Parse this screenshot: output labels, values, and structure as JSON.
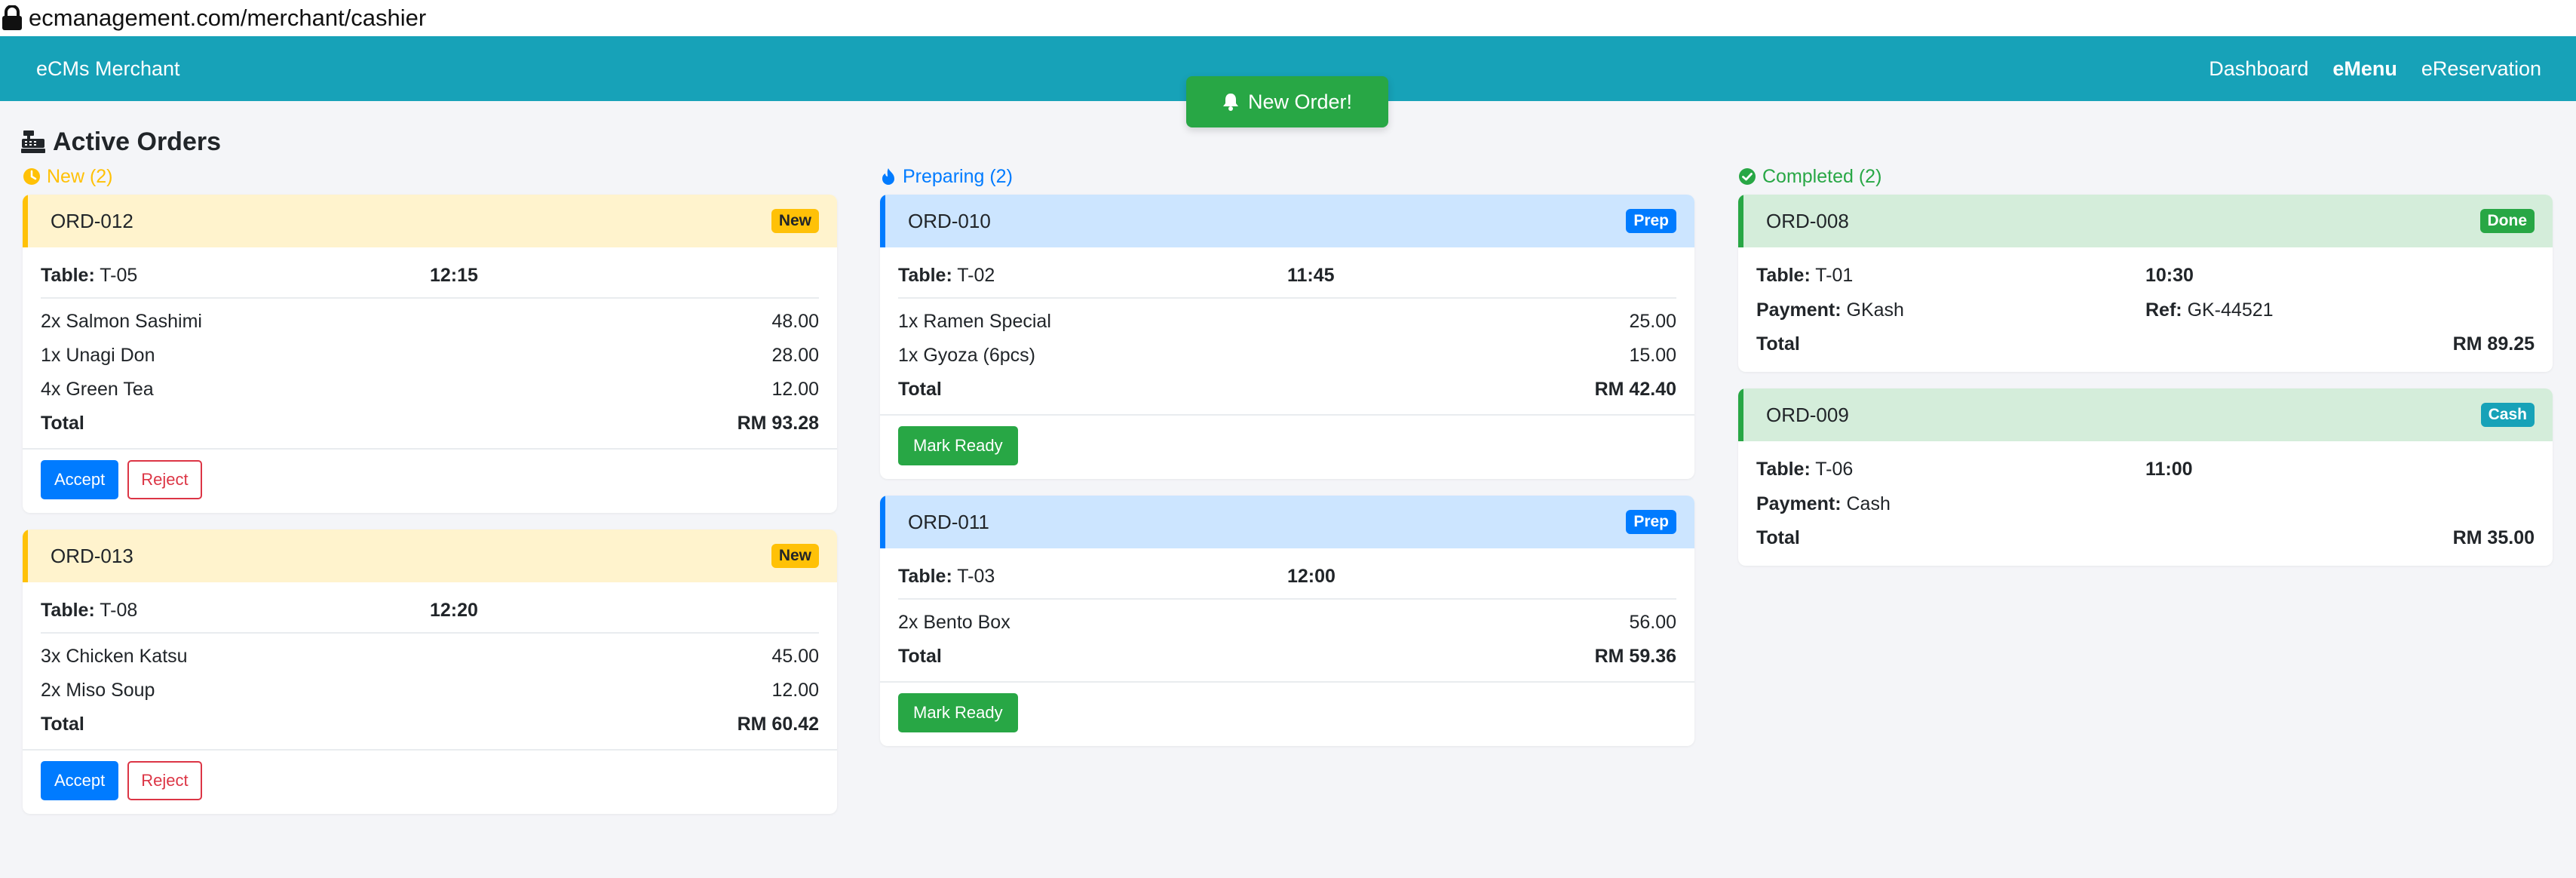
{
  "browser": {
    "url": "ecmanagement.com/merchant/cashier"
  },
  "navbar": {
    "brand": "eCMs Merchant",
    "links": [
      {
        "label": "Dashboard",
        "active": false
      },
      {
        "label": "eMenu",
        "active": true
      },
      {
        "label": "eReservation",
        "active": false
      }
    ]
  },
  "new_order_button": {
    "label": "New Order!"
  },
  "page": {
    "title": "Active Orders"
  },
  "columns": {
    "new": {
      "heading": "New (2)",
      "color": "#ffc107",
      "orders": [
        {
          "id": "ORD-012",
          "badge": "New",
          "table_label": "Table:",
          "table": "T-05",
          "time": "12:15",
          "items": [
            {
              "name": "2x Salmon Sashimi",
              "price": "48.00"
            },
            {
              "name": "1x Unagi Don",
              "price": "28.00"
            },
            {
              "name": "4x Green Tea",
              "price": "12.00"
            }
          ],
          "total_label": "Total",
          "total": "RM 93.28",
          "accept_label": "Accept",
          "reject_label": "Reject"
        },
        {
          "id": "ORD-013",
          "badge": "New",
          "table_label": "Table:",
          "table": "T-08",
          "time": "12:20",
          "items": [
            {
              "name": "3x Chicken Katsu",
              "price": "45.00"
            },
            {
              "name": "2x Miso Soup",
              "price": "12.00"
            }
          ],
          "total_label": "Total",
          "total": "RM 60.42",
          "accept_label": "Accept",
          "reject_label": "Reject"
        }
      ]
    },
    "preparing": {
      "heading": "Preparing (2)",
      "color": "#007bff",
      "orders": [
        {
          "id": "ORD-010",
          "badge": "Prep",
          "table_label": "Table:",
          "table": "T-02",
          "time": "11:45",
          "items": [
            {
              "name": "1x Ramen Special",
              "price": "25.00"
            },
            {
              "name": "1x Gyoza (6pcs)",
              "price": "15.00"
            }
          ],
          "total_label": "Total",
          "total": "RM 42.40",
          "ready_label": "Mark Ready"
        },
        {
          "id": "ORD-011",
          "badge": "Prep",
          "table_label": "Table:",
          "table": "T-03",
          "time": "12:00",
          "items": [
            {
              "name": "2x Bento Box",
              "price": "56.00"
            }
          ],
          "total_label": "Total",
          "total": "RM 59.36",
          "ready_label": "Mark Ready"
        }
      ]
    },
    "completed": {
      "heading": "Completed (2)",
      "color": "#28a745",
      "orders": [
        {
          "id": "ORD-008",
          "badge": "Done",
          "table_label": "Table:",
          "table": "T-01",
          "time": "10:30",
          "payment_label": "Payment:",
          "payment": "GKash",
          "ref_label": "Ref:",
          "ref": "GK-44521",
          "total_label": "Total",
          "total": "RM 89.25"
        },
        {
          "id": "ORD-009",
          "badge": "Cash",
          "table_label": "Table:",
          "table": "T-06",
          "time": "11:00",
          "payment_label": "Payment:",
          "payment": "Cash",
          "total_label": "Total",
          "total": "RM 35.00"
        }
      ]
    }
  },
  "colors": {
    "navbar": "#17a2b8",
    "new_header_bg": "#fff3cd",
    "prep_header_bg": "#cce5ff",
    "done_header_bg": "#d4edda",
    "primary": "#007bff",
    "success": "#28a745",
    "warning": "#ffc107",
    "danger": "#dc3545",
    "info": "#17a2b8"
  },
  "icons": {
    "lock": "lock-icon",
    "bell": "bell-icon",
    "register": "cash-register-icon",
    "clock": "clock-icon",
    "fire": "fire-icon",
    "check": "check-circle-icon"
  }
}
